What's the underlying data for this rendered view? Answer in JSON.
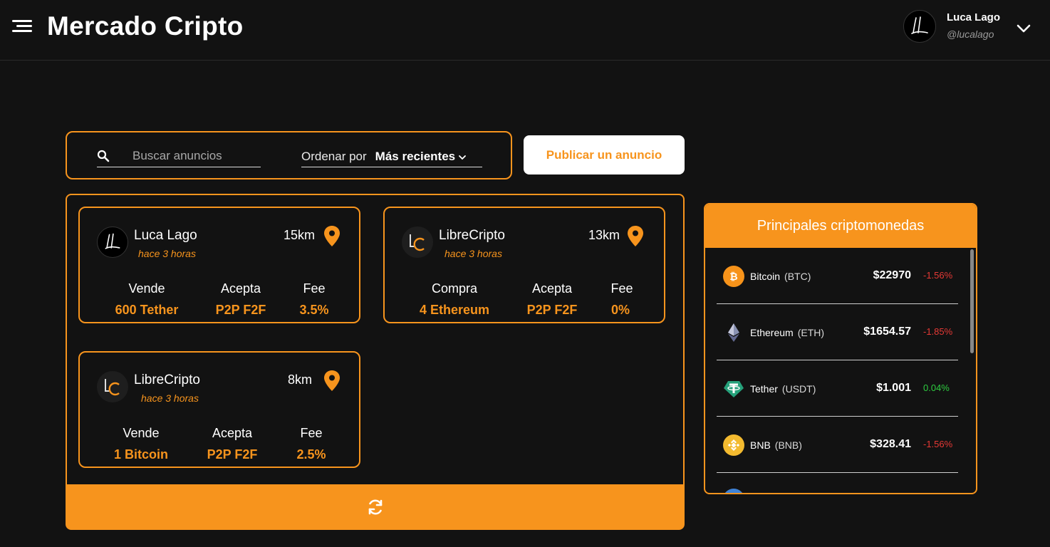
{
  "header": {
    "title": "Mercado Cripto",
    "user": {
      "name": "Luca Lago",
      "handle": "@lucalago"
    }
  },
  "toolbar": {
    "search_placeholder": "Buscar anuncios",
    "sort_label": "Ordenar por",
    "sort_value": "Más recientes",
    "publish_label": "Publicar un anuncio"
  },
  "ads": [
    {
      "name": "Luca Lago",
      "time": "hace 3 horas",
      "distance": "15km",
      "avatar": "user",
      "type_label": "Vende",
      "type_value": "600 Tether",
      "accepts_label": "Acepta",
      "accepts_value": "P2P F2F",
      "fee_label": "Fee",
      "fee_value": "3.5%"
    },
    {
      "name": "LibreCripto",
      "time": "hace 3 horas",
      "distance": "13km",
      "avatar": "lc",
      "type_label": "Compra",
      "type_value": "4 Ethereum",
      "accepts_label": "Acepta",
      "accepts_value": "P2P F2F",
      "fee_label": "Fee",
      "fee_value": "0%"
    },
    {
      "name": "LibreCripto",
      "time": "hace 3 horas",
      "distance": "8km",
      "avatar": "lc",
      "type_label": "Vende",
      "type_value": "1 Bitcoin",
      "accepts_label": "Acepta",
      "accepts_value": "P2P F2F",
      "fee_label": "Fee",
      "fee_value": "2.5%"
    }
  ],
  "crypto_panel": {
    "title": "Principales criptomonedas",
    "coins": [
      {
        "name": "Bitcoin",
        "symbol": "(BTC)",
        "price": "$22970",
        "change": "-1.56%",
        "trend": "down",
        "icon": "bitcoin-icon"
      },
      {
        "name": "Ethereum",
        "symbol": "(ETH)",
        "price": "$1654.57",
        "change": "-1.85%",
        "trend": "down",
        "icon": "ethereum-icon"
      },
      {
        "name": "Tether",
        "symbol": "(USDT)",
        "price": "$1.001",
        "change": "0.04%",
        "trend": "up",
        "icon": "tether-icon"
      },
      {
        "name": "BNB",
        "symbol": "(BNB)",
        "price": "$328.41",
        "change": "-1.56%",
        "trend": "down",
        "icon": "bnb-icon"
      }
    ]
  },
  "colors": {
    "accent": "#f7941d",
    "background": "#121212",
    "negative": "#e53935",
    "positive": "#2ecc40"
  }
}
